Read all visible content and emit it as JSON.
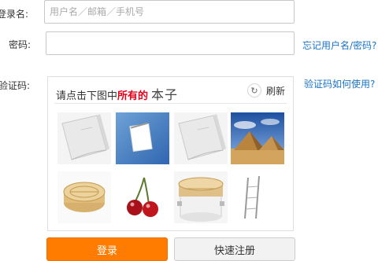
{
  "form": {
    "username_label": "登录名:",
    "username_placeholder": "用户名／邮箱／手机号",
    "password_label": "密码:",
    "forgot_link": "忘记用户名/密码?",
    "captcha_label": "验证码:",
    "captcha_help_link": "验证码如何使用?"
  },
  "captcha": {
    "instruction_prefix": "请点击下图中",
    "instruction_highlight": "所有的",
    "target_word": "本子",
    "refresh_label": "刷新",
    "tiles": [
      "notebook-photo",
      "notepad-photo",
      "notebook-photo",
      "pyramids-photo",
      "bamboo-steamer-photo",
      "cherries-photo",
      "steamer-pot-photo",
      "rack-photo"
    ]
  },
  "buttons": {
    "login_label": "登录",
    "register_label": "快速注册"
  },
  "colors": {
    "primary": "#ff7c00",
    "link": "#1a73c7",
    "highlight": "#e5001b"
  }
}
